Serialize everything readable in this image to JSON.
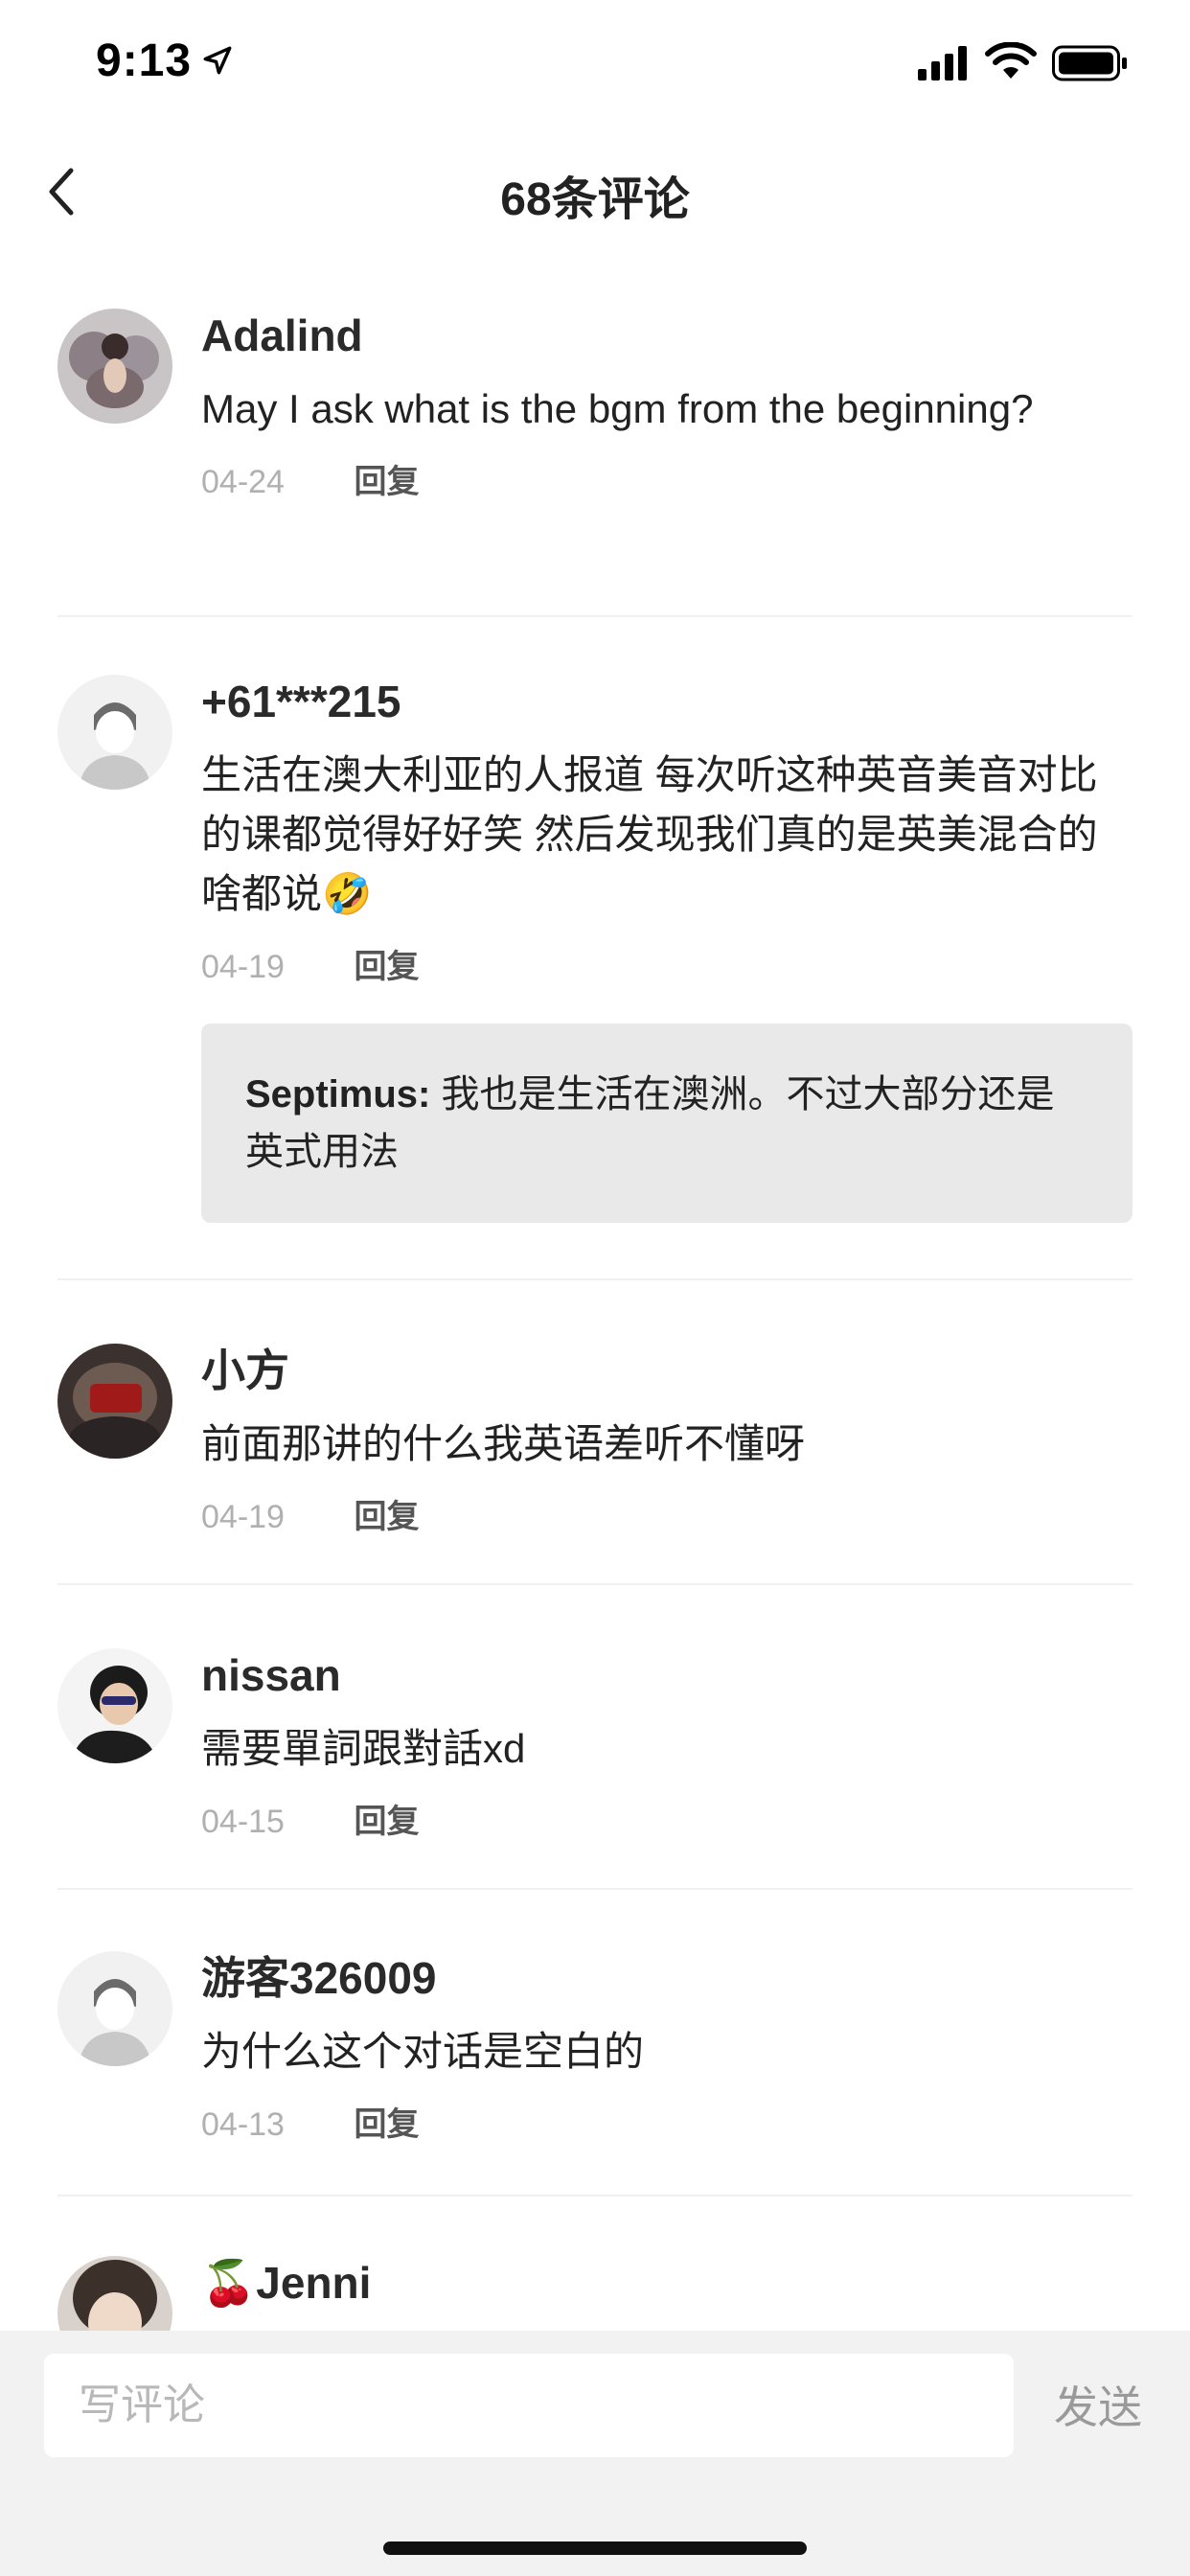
{
  "status_bar": {
    "time": "9:13"
  },
  "nav": {
    "title": "68条评论"
  },
  "comments": [
    {
      "name": "Adalind",
      "text": "May I ask what is the bgm from the beginning?",
      "date": "04-24",
      "reply_label": "回复"
    },
    {
      "name": "+61***215",
      "text": "生活在澳大利亚的人报道 每次听这种英音美音对比的课都觉得好好笑 然后发现我们真的是英美混合的 啥都说🤣",
      "date": "04-19",
      "reply_label": "回复",
      "reply": {
        "author": "Septimus:",
        "text": "我也是生活在澳洲。不过大部分还是英式用法"
      }
    },
    {
      "name": "小方",
      "text": "前面那讲的什么我英语差听不懂呀",
      "date": "04-19",
      "reply_label": "回复"
    },
    {
      "name": "nissan",
      "text": "需要單詞跟對話xd",
      "date": "04-15",
      "reply_label": "回复"
    },
    {
      "name": "游客326009",
      "text": "为什么这个对话是空白的",
      "date": "04-13",
      "reply_label": "回复"
    },
    {
      "name": "🍒Jenni"
    }
  ],
  "input": {
    "placeholder": "写评论",
    "send_label": "发送"
  },
  "icons": [
    "location-arrow-icon",
    "signal-icon",
    "wifi-icon",
    "battery-icon",
    "back-chevron-icon"
  ]
}
